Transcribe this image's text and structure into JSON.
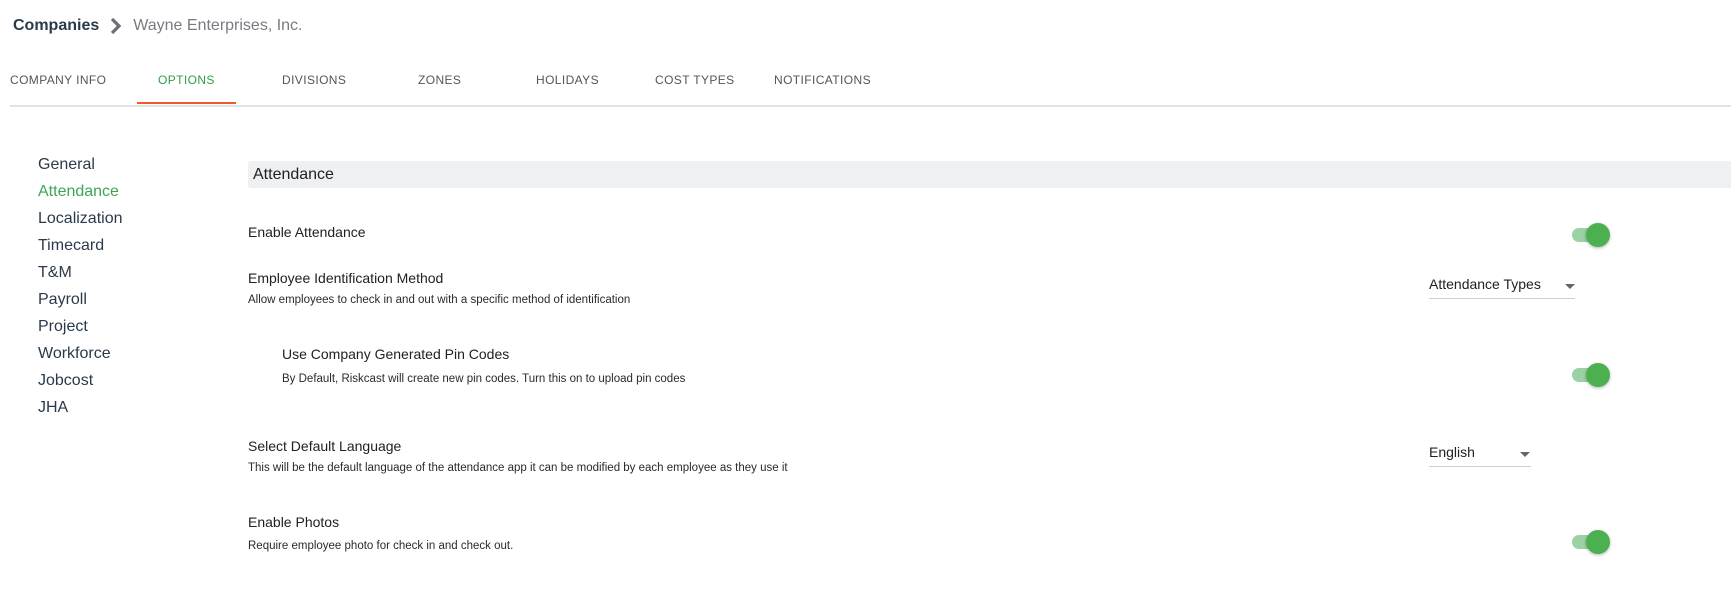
{
  "breadcrumb": {
    "root": "Companies",
    "current": "Wayne Enterprises, Inc."
  },
  "tabs": [
    {
      "label": "COMPANY INFO"
    },
    {
      "label": "OPTIONS"
    },
    {
      "label": "DIVISIONS"
    },
    {
      "label": "ZONES"
    },
    {
      "label": "HOLIDAYS"
    },
    {
      "label": "COST TYPES"
    },
    {
      "label": "NOTIFICATIONS"
    }
  ],
  "active_tab": "OPTIONS",
  "sidenav": {
    "items": [
      {
        "label": "General"
      },
      {
        "label": "Attendance"
      },
      {
        "label": "Localization"
      },
      {
        "label": "Timecard"
      },
      {
        "label": "T&M"
      },
      {
        "label": "Payroll"
      },
      {
        "label": "Project"
      },
      {
        "label": "Workforce"
      },
      {
        "label": "Jobcost"
      },
      {
        "label": "JHA"
      }
    ],
    "active": "Attendance"
  },
  "section": {
    "title": "Attendance"
  },
  "settings": {
    "enable_attendance": {
      "title": "Enable Attendance",
      "enabled": true
    },
    "identification_method": {
      "title": "Employee Identification Method",
      "description": "Allow employees to check in and out with a specific method of identification",
      "value": "Attendance Types"
    },
    "pin_codes": {
      "title": "Use Company Generated Pin Codes",
      "description": "By Default, Riskcast will create new pin codes. Turn this on to upload pin codes",
      "enabled": true
    },
    "default_language": {
      "title": "Select Default Language",
      "description": "This will be the default language of the attendance app it can be modified by each employee as they use it",
      "value": "English"
    },
    "enable_photos": {
      "title": "Enable Photos",
      "description": "Require employee photo for check in and check out.",
      "enabled": true
    }
  },
  "colors": {
    "accent_green": "#4caf50",
    "active_tab_text": "#2e9e47",
    "tab_underline": "#ef5a2a",
    "section_header_bg": "#eef0f2"
  }
}
